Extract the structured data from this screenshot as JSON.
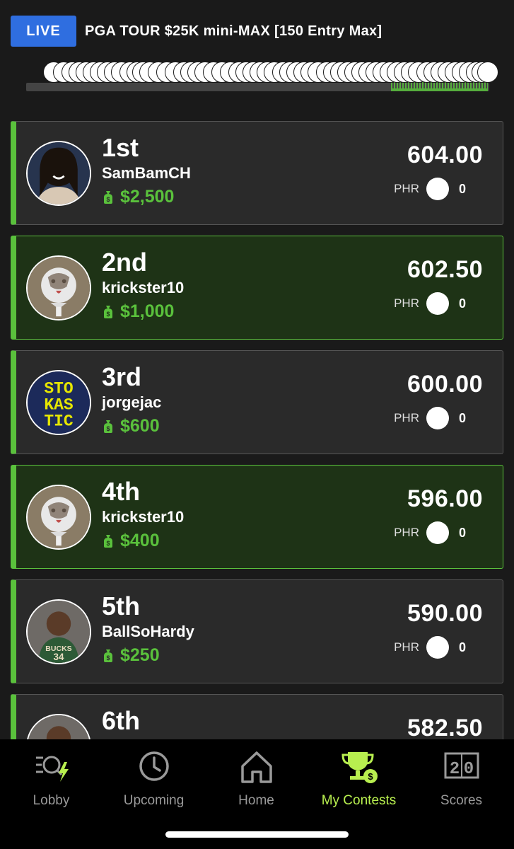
{
  "header": {
    "live_badge": "LIVE",
    "contest_title": "PGA TOUR $25K mini-MAX [150 Entry Max]"
  },
  "standings": [
    {
      "place": "1st",
      "user": "SamBamCH",
      "prize": "$2,500",
      "points": "604.00",
      "phr_label": "PHR",
      "phr_value": "0",
      "mine": false
    },
    {
      "place": "2nd",
      "user": "krickster10",
      "prize": "$1,000",
      "points": "602.50",
      "phr_label": "PHR",
      "phr_value": "0",
      "mine": true
    },
    {
      "place": "3rd",
      "user": "jorgejac",
      "prize": "$600",
      "points": "600.00",
      "phr_label": "PHR",
      "phr_value": "0",
      "mine": false
    },
    {
      "place": "4th",
      "user": "krickster10",
      "prize": "$400",
      "points": "596.00",
      "phr_label": "PHR",
      "phr_value": "0",
      "mine": true
    },
    {
      "place": "5th",
      "user": "BallSoHardy",
      "prize": "$250",
      "points": "590.00",
      "phr_label": "PHR",
      "phr_value": "0",
      "mine": false
    },
    {
      "place": "6th",
      "user": "",
      "prize": "",
      "points": "582.50",
      "phr_label": "",
      "phr_value": "",
      "mine": false
    }
  ],
  "tabs": [
    {
      "label": "Lobby",
      "icon": "lobby-icon"
    },
    {
      "label": "Upcoming",
      "icon": "clock-icon"
    },
    {
      "label": "Home",
      "icon": "home-icon"
    },
    {
      "label": "My Contests",
      "icon": "trophy-icon",
      "active": true
    },
    {
      "label": "Scores",
      "icon": "scoreboard-icon"
    }
  ],
  "colors": {
    "accent_green": "#5ac13c",
    "active_tab": "#b8ef4f",
    "live_blue": "#2f6ee0"
  }
}
